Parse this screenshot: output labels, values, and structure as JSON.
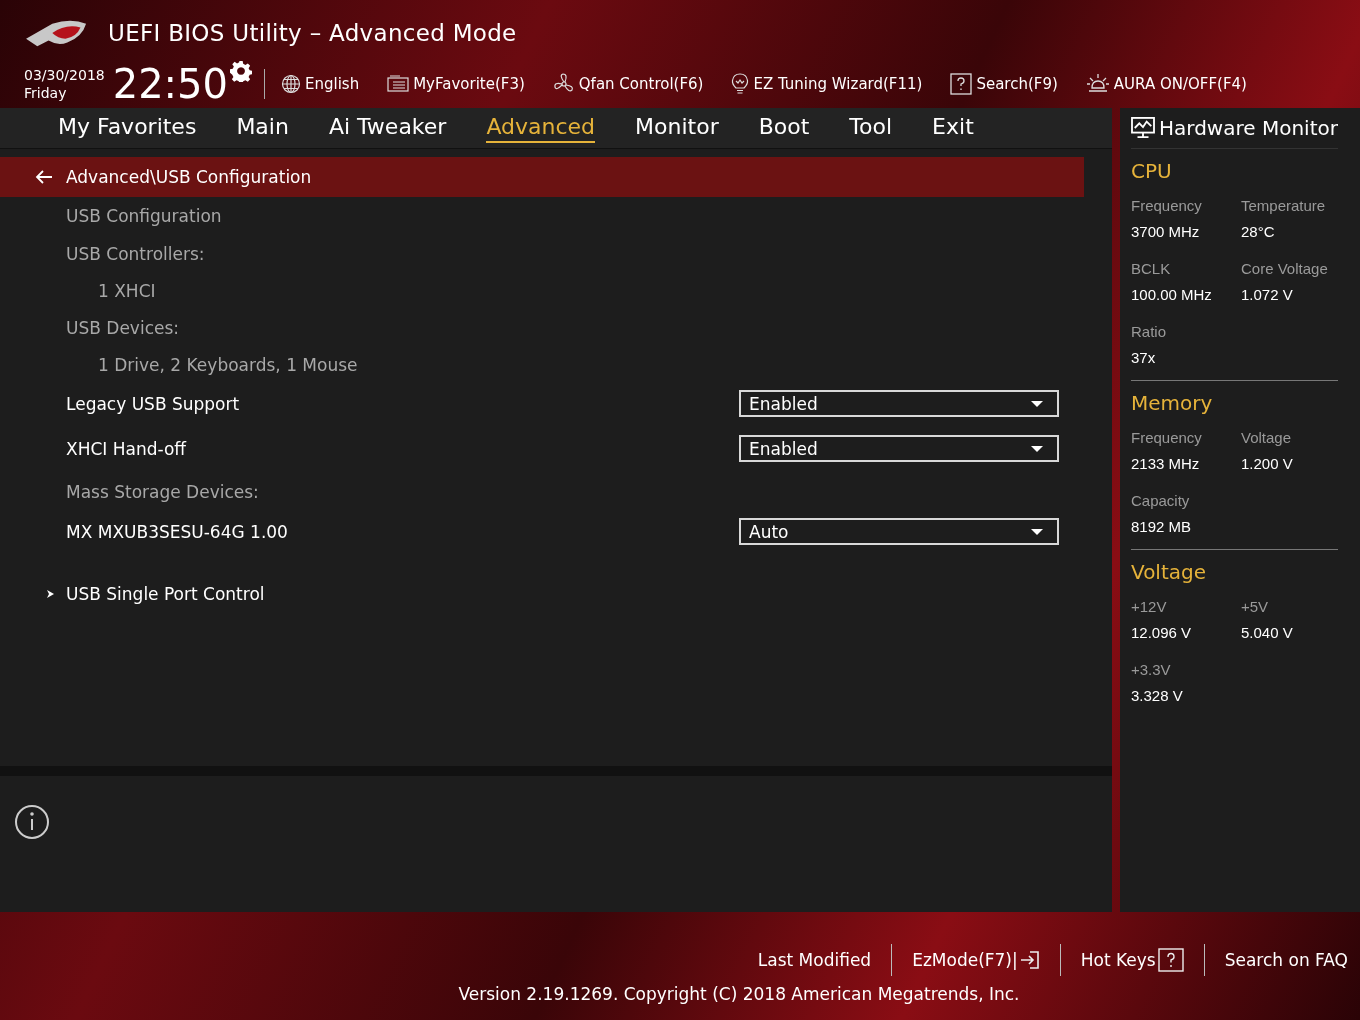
{
  "header": {
    "title": "UEFI BIOS Utility – Advanced Mode",
    "date": "03/30/2018",
    "day": "Friday",
    "time": "22:50",
    "toolbar": [
      "English",
      "MyFavorite(F3)",
      "Qfan Control(F6)",
      "EZ Tuning Wizard(F11)",
      "Search(F9)",
      "AURA ON/OFF(F4)"
    ]
  },
  "tabs": [
    {
      "label": "My Favorites",
      "selected": false
    },
    {
      "label": "Main",
      "selected": false
    },
    {
      "label": "Ai Tweaker",
      "selected": false
    },
    {
      "label": "Advanced",
      "selected": true
    },
    {
      "label": "Monitor",
      "selected": false
    },
    {
      "label": "Boot",
      "selected": false
    },
    {
      "label": "Tool",
      "selected": false
    },
    {
      "label": "Exit",
      "selected": false
    }
  ],
  "breadcrumb": "Advanced\\USB Configuration",
  "items": [
    {
      "kind": "label",
      "text": "USB Configuration"
    },
    {
      "kind": "label",
      "text": "USB Controllers:"
    },
    {
      "kind": "detail",
      "text": "1 XHCI"
    },
    {
      "kind": "label",
      "text": "USB Devices:"
    },
    {
      "kind": "detail",
      "text": "1 Drive, 2 Keyboards, 1 Mouse"
    },
    {
      "kind": "setting",
      "text": "Legacy USB Support",
      "value": "Enabled"
    },
    {
      "kind": "setting",
      "text": "XHCI Hand-off",
      "value": "Enabled"
    },
    {
      "kind": "label",
      "text": "Mass Storage Devices:"
    },
    {
      "kind": "setting",
      "text": "MX MXUB3SESU-64G 1.00",
      "value": "Auto"
    },
    {
      "kind": "submenu",
      "text": "USB Single Port Control"
    }
  ],
  "hardware_monitor": {
    "title": "Hardware Monitor",
    "sections": [
      {
        "title": "CPU",
        "readings": [
          {
            "label": "Frequency",
            "value": "3700 MHz"
          },
          {
            "label": "Temperature",
            "value": "28°C"
          },
          {
            "label": "BCLK",
            "value": "100.00 MHz"
          },
          {
            "label": "Core Voltage",
            "value": "1.072 V"
          },
          {
            "label": "Ratio",
            "value": "37x"
          }
        ]
      },
      {
        "title": "Memory",
        "readings": [
          {
            "label": "Frequency",
            "value": "2133 MHz"
          },
          {
            "label": "Voltage",
            "value": "1.200 V"
          },
          {
            "label": "Capacity",
            "value": "8192 MB"
          }
        ]
      },
      {
        "title": "Voltage",
        "readings": [
          {
            "label": "+12V",
            "value": "12.096 V"
          },
          {
            "label": "+5V",
            "value": "5.040 V"
          },
          {
            "label": "+3.3V",
            "value": "3.328 V"
          }
        ]
      }
    ]
  },
  "footer": {
    "links": [
      "Last Modified",
      "EzMode(F7)|",
      "Hot Keys"
    ],
    "faq": "Search on FAQ",
    "version": "Version 2.19.1269. Copyright (C) 2018 American Megatrends, Inc."
  }
}
